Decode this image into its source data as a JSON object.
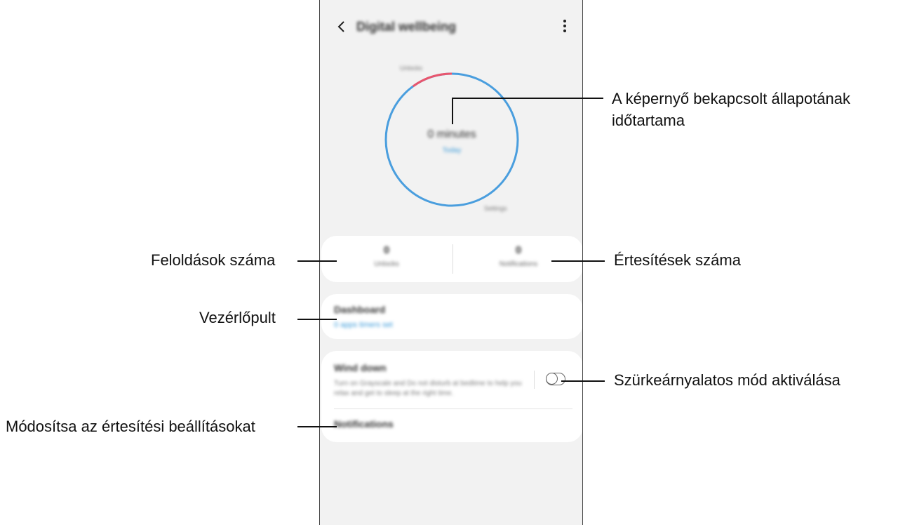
{
  "phone": {
    "app_title": "Digital wellbeing",
    "ring": {
      "screen_time": "0 minutes",
      "today_label": "Today",
      "label_top": "Unlocks",
      "label_bottom": "Settings",
      "ring_color": "#4a9ede",
      "segment_color": "#e8566e",
      "segment_fraction": 0.1
    },
    "counts": {
      "unlocks_value": "0",
      "unlocks_label": "Unlocks",
      "notifications_value": "0",
      "notifications_label": "Notifications"
    },
    "dashboard": {
      "title": "Dashboard",
      "subtitle": "0 apps timers set"
    },
    "wind_down": {
      "title": "Wind down",
      "description": "Turn on Grayscale and Do not disturb at bedtime to help you relax and get to sleep at the right time.",
      "toggle_on": false,
      "notifications_label": "Notifications"
    }
  },
  "callouts": {
    "screen_time": "A képernyő bekapcsolt állapotának időtartama",
    "screen_time_line1": "A képernyő bekapcsolt állapotának",
    "screen_time_line2": "időtartama",
    "unlocks": "Feloldások száma",
    "notifications_count": "Értesítések száma",
    "dashboard": "Vezérlőpult",
    "grayscale": "Szürkeárnyalatos mód aktiválása",
    "notification_settings": "Módosítsa az értesítési beállításokat"
  }
}
